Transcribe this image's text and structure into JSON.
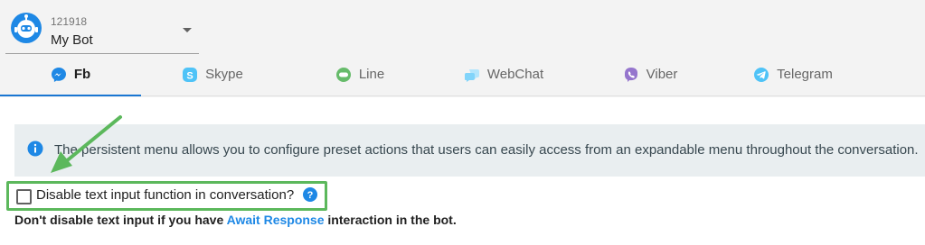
{
  "bot": {
    "id": "121918",
    "name": "My Bot"
  },
  "tabs": [
    {
      "label": "Fb",
      "icon": "messenger-icon",
      "active": true
    },
    {
      "label": "Skype",
      "icon": "skype-icon",
      "active": false
    },
    {
      "label": "Line",
      "icon": "line-icon",
      "active": false
    },
    {
      "label": "WebChat",
      "icon": "webchat-icon",
      "active": false
    },
    {
      "label": "Viber",
      "icon": "viber-icon",
      "active": false
    },
    {
      "label": "Telegram",
      "icon": "telegram-icon",
      "active": false
    }
  ],
  "info": {
    "icon": "info-icon",
    "text": "The persistent menu allows you to configure preset actions that users can easily access from an expandable menu throughout the conversation."
  },
  "option": {
    "label": "Disable text input function in conversation?",
    "checked": false,
    "help_icon": "help-icon"
  },
  "warning": {
    "prefix": "Don't disable text input if you have ",
    "link": "Await Response",
    "suffix": " interaction in the bot."
  },
  "colors": {
    "accent": "#1976d2",
    "highlight": "#5cb85c",
    "link": "#1e88e5",
    "info_bg": "#e9eef0"
  }
}
